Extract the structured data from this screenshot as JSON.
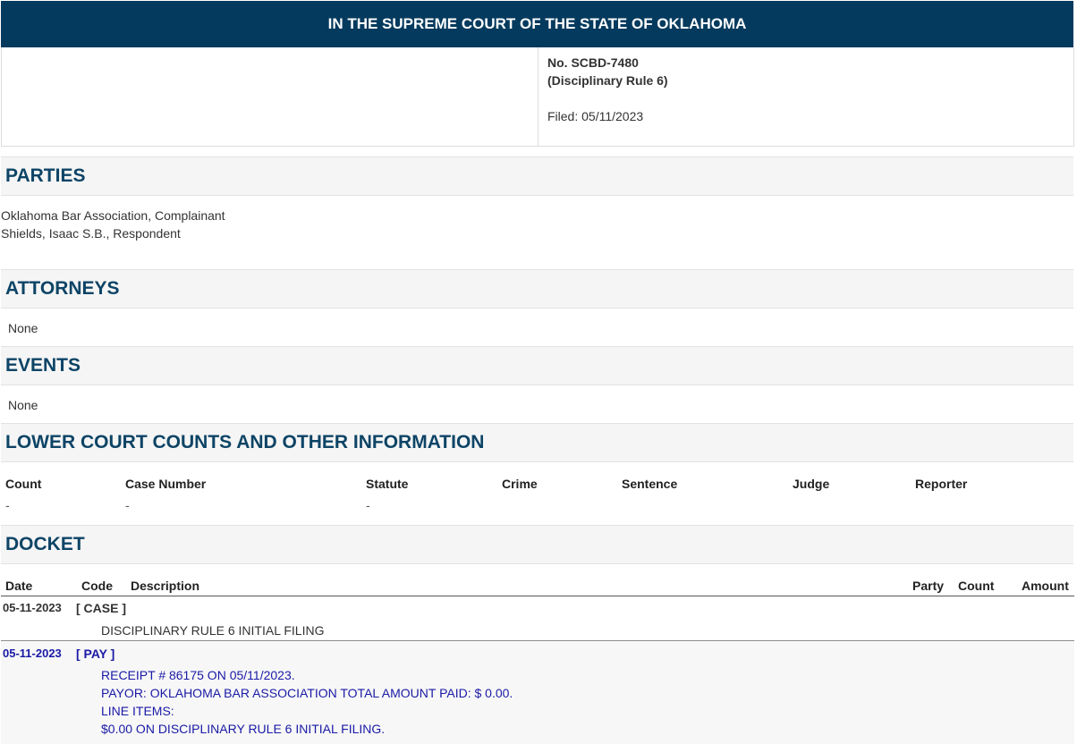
{
  "banner": {
    "title": "IN THE SUPREME COURT OF THE STATE OF OKLAHOMA"
  },
  "case": {
    "number": "No. SCBD-7480",
    "type": "(Disciplinary Rule 6)",
    "filed": "Filed: 05/11/2023"
  },
  "parties": {
    "heading": "PARTIES",
    "items": [
      "Oklahoma Bar Association, Complainant",
      "Shields, Isaac S.B., Respondent"
    ]
  },
  "attorneys": {
    "heading": "ATTORNEYS",
    "value": "None"
  },
  "events": {
    "heading": "EVENTS",
    "value": "None"
  },
  "lower_court": {
    "heading": "LOWER COURT COUNTS AND OTHER INFORMATION",
    "columns": [
      "Count",
      "Case Number",
      "Statute",
      "Crime",
      "Sentence",
      "Judge",
      "Reporter"
    ],
    "row": [
      "-",
      "-",
      "-"
    ]
  },
  "docket": {
    "heading": "DOCKET",
    "columns": {
      "date": "Date",
      "code": "Code",
      "description": "Description",
      "party": "Party",
      "count": "Count",
      "amount": "Amount"
    },
    "entries": [
      {
        "date": "05-11-2023",
        "code": "[ CASE ]",
        "lines": [
          "DISCIPLINARY RULE 6 INITIAL FILING"
        ]
      },
      {
        "date": "05-11-2023",
        "code": "[ PAY ]",
        "lines": [
          "RECEIPT # 86175 ON 05/11/2023.",
          "PAYOR: OKLAHOMA BAR ASSOCIATION TOTAL AMOUNT PAID: $ 0.00.",
          "LINE ITEMS:",
          "$0.00 ON DISCIPLINARY RULE 6 INITIAL FILING."
        ]
      }
    ]
  },
  "colors": {
    "banner": "#043a5e",
    "heading": "#0d4466",
    "pay_link": "#1a1aa6"
  }
}
